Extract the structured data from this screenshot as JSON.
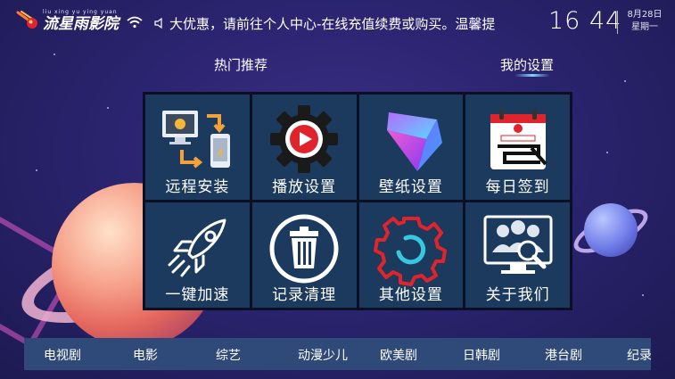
{
  "status_bar": {
    "logo_pinyin": "liu xing yu ying yuan",
    "logo_title": "流星雨影院",
    "ticker_text": "大优惠，请前往个人中心-在线充值续费或购买。温馨提",
    "clock": "16 44",
    "date": "8月28日",
    "weekday": "星期一"
  },
  "top_nav": {
    "hot": "热门推荐",
    "mine": "我的设置"
  },
  "tiles": [
    {
      "label": "远程安装",
      "icon": "remote-install-icon"
    },
    {
      "label": "播放设置",
      "icon": "play-settings-gear-icon"
    },
    {
      "label": "壁纸设置",
      "icon": "wallpaper-cube-icon"
    },
    {
      "label": "每日签到",
      "icon": "calendar-checkin-icon"
    },
    {
      "label": "一键加速",
      "icon": "rocket-icon"
    },
    {
      "label": "记录清理",
      "icon": "trash-can-icon"
    },
    {
      "label": "其他设置",
      "icon": "red-gear-icon"
    },
    {
      "label": "关于我们",
      "icon": "about-us-monitor-icon"
    }
  ],
  "categories": [
    "电视剧",
    "电影",
    "综艺",
    "动漫少儿",
    "欧美剧",
    "日韩剧",
    "港台剧",
    "纪录"
  ],
  "colors": {
    "tile_bg": "#1c3a5e",
    "panel_bg": "#0b0f24",
    "category_bar_bg": "#2f4a78",
    "accent_red": "#e0242b"
  }
}
